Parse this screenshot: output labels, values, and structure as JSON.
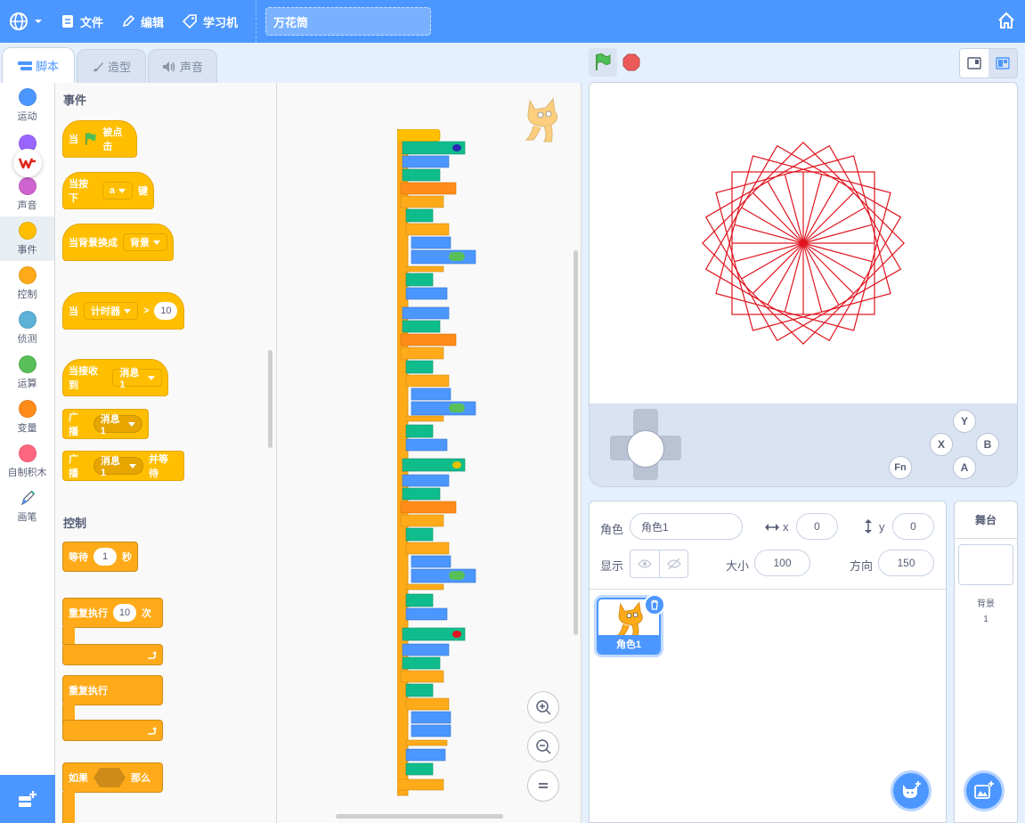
{
  "menubar": {
    "file": "文件",
    "edit": "编辑",
    "tutorials": "学习机",
    "project_title": "万花筒"
  },
  "tabs": [
    {
      "label": "脚本"
    },
    {
      "label": "造型"
    },
    {
      "label": "声音"
    }
  ],
  "categories": [
    {
      "label": "运动",
      "color": "#4c97ff"
    },
    {
      "label": "",
      "color": "#9966ff"
    },
    {
      "label": "声音",
      "color": "#cf63cf"
    },
    {
      "label": "事件",
      "color": "#ffbf00"
    },
    {
      "label": "控制",
      "color": "#ffab19"
    },
    {
      "label": "侦测",
      "color": "#5cb1d6"
    },
    {
      "label": "运算",
      "color": "#59c059"
    },
    {
      "label": "变量",
      "color": "#ff8c1a"
    },
    {
      "label": "自制积木",
      "color": "#ff6680"
    },
    {
      "label": "画笔",
      "color": "#0fbd8c"
    }
  ],
  "palette": {
    "events_heading": "事件",
    "when_flag": {
      "pre": "当",
      "post": "被点击"
    },
    "when_key": {
      "pre": "当按下",
      "key": "a",
      "post": "键"
    },
    "when_backdrop": {
      "pre": "当背景换成",
      "value": "背景"
    },
    "when_timer": {
      "pre": "当",
      "sensor": "计时器",
      "op": ">",
      "value": "10"
    },
    "when_receive": {
      "pre": "当接收到",
      "value": "消息1"
    },
    "broadcast": {
      "pre": "广播",
      "value": "消息1"
    },
    "broadcast_wait": {
      "pre": "广播",
      "value": "消息1",
      "post": "并等待"
    },
    "control_heading": "控制",
    "wait": {
      "pre": "等待",
      "value": "1",
      "post": "秒"
    },
    "repeat": {
      "pre": "重复执行",
      "value": "10",
      "post": "次"
    },
    "forever": {
      "label": "重复执行"
    },
    "if_then": {
      "pre": "如果",
      "post": "那么"
    }
  },
  "sprite_info": {
    "sprite_label": "角色",
    "sprite_name": "角色1",
    "x_label": "x",
    "x_value": "0",
    "y_label": "y",
    "y_value": "0",
    "show_label": "显示",
    "size_label": "大小",
    "size_value": "100",
    "direction_label": "方向",
    "direction_value": "150"
  },
  "sprite_tile": {
    "name": "角色1"
  },
  "stage_panel": {
    "header": "舞台",
    "backdrops_label": "背景",
    "backdrops_count": "1"
  },
  "gamepad": {
    "buttons": {
      "y": "Y",
      "x": "X",
      "b": "B",
      "a": "A",
      "fn": "Fn"
    }
  },
  "colors": {
    "accent": "#4c97ff",
    "events": "#ffbf00",
    "control": "#ffab19",
    "pen_line": "#e0141e"
  }
}
